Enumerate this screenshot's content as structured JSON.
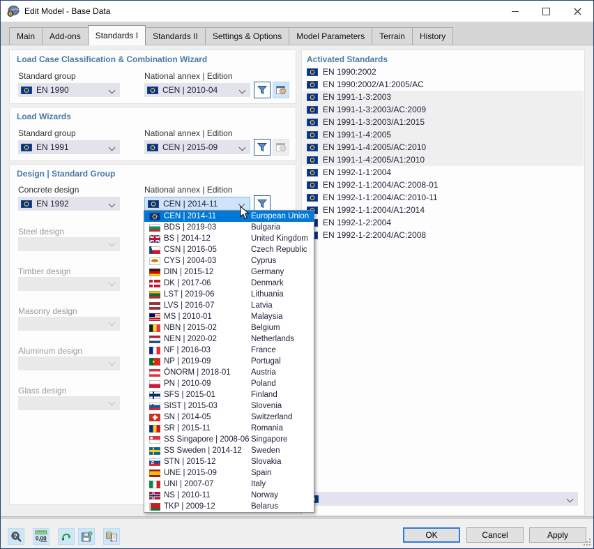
{
  "colors": {
    "accent": "#0078d7",
    "header_blue": "#4a7aa8",
    "selection": "#0078d7"
  },
  "window": {
    "title": "Edit Model - Base Data"
  },
  "tabs": [
    {
      "label": "Main"
    },
    {
      "label": "Add-ons"
    },
    {
      "label": "Standards I",
      "active": true
    },
    {
      "label": "Standards II"
    },
    {
      "label": "Settings & Options"
    },
    {
      "label": "Model Parameters"
    },
    {
      "label": "Terrain"
    },
    {
      "label": "History"
    }
  ],
  "panels": {
    "lcc": {
      "title": "Load Case Classification & Combination Wizard",
      "group_label": "Standard group",
      "group_value": "EN 1990",
      "annex_label": "National annex | Edition",
      "annex_value": "CEN | 2010-04"
    },
    "wizards": {
      "title": "Load Wizards",
      "group_label": "Standard group",
      "group_value": "EN 1991",
      "annex_label": "National annex | Edition",
      "annex_value": "CEN | 2015-09"
    },
    "design": {
      "title": "Design | Standard Group",
      "concrete_label": "Concrete design",
      "concrete_value": "EN 1992",
      "annex_label": "National annex | Edition",
      "annex_value": "CEN | 2014-11",
      "disabled": [
        {
          "label": "Steel design"
        },
        {
          "label": "Timber design"
        },
        {
          "label": "Masonry design"
        },
        {
          "label": "Aluminum design"
        },
        {
          "label": "Glass design"
        }
      ]
    }
  },
  "annex_dropdown": {
    "items": [
      {
        "flag": "eu",
        "code": "CEN | 2014-11",
        "country": "European Union",
        "selected": true
      },
      {
        "flag": "bg",
        "code": "BDS | 2019-03",
        "country": "Bulgaria"
      },
      {
        "flag": "gb",
        "code": "BS | 2014-12",
        "country": "United Kingdom"
      },
      {
        "flag": "cz",
        "code": "CSN | 2016-05",
        "country": "Czech Republic"
      },
      {
        "flag": "cy",
        "code": "CYS | 2004-03",
        "country": "Cyprus"
      },
      {
        "flag": "de",
        "code": "DIN | 2015-12",
        "country": "Germany"
      },
      {
        "flag": "dk",
        "code": "DK | 2017-06",
        "country": "Denmark"
      },
      {
        "flag": "lt",
        "code": "LST | 2019-06",
        "country": "Lithuania"
      },
      {
        "flag": "lv",
        "code": "LVS | 2016-07",
        "country": "Latvia"
      },
      {
        "flag": "my",
        "code": "MS | 2010-01",
        "country": "Malaysia"
      },
      {
        "flag": "be",
        "code": "NBN | 2015-02",
        "country": "Belgium"
      },
      {
        "flag": "nl",
        "code": "NEN | 2020-02",
        "country": "Netherlands"
      },
      {
        "flag": "fr",
        "code": "NF | 2016-03",
        "country": "France"
      },
      {
        "flag": "pt",
        "code": "NP | 2019-09",
        "country": "Portugal"
      },
      {
        "flag": "at",
        "code": "ÖNORM | 2018-01",
        "country": "Austria"
      },
      {
        "flag": "pl",
        "code": "PN | 2010-09",
        "country": "Poland"
      },
      {
        "flag": "fi",
        "code": "SFS | 2015-01",
        "country": "Finland"
      },
      {
        "flag": "si",
        "code": "SIST | 2015-03",
        "country": "Slovenia"
      },
      {
        "flag": "ch",
        "code": "SN | 2014-05",
        "country": "Switzerland"
      },
      {
        "flag": "ro",
        "code": "SR | 2015-11",
        "country": "Romania"
      },
      {
        "flag": "sg",
        "code": "SS Singapore | 2008-06",
        "country": "Singapore"
      },
      {
        "flag": "se",
        "code": "SS Sweden | 2014-12",
        "country": "Sweden"
      },
      {
        "flag": "sk",
        "code": "STN | 2015-12",
        "country": "Slovakia"
      },
      {
        "flag": "es",
        "code": "UNE | 2015-09",
        "country": "Spain"
      },
      {
        "flag": "it",
        "code": "UNI | 2007-07",
        "country": "Italy"
      },
      {
        "flag": "no",
        "code": "NS | 2010-11",
        "country": "Norway"
      },
      {
        "flag": "by",
        "code": "TKP | 2009-12",
        "country": "Belarus"
      }
    ]
  },
  "activated": {
    "title": "Activated Standards",
    "items": [
      {
        "flag": "eu",
        "label": "EN 1990:2002"
      },
      {
        "flag": "eu",
        "label": "EN 1990:2002/A1:2005/AC"
      },
      {
        "flag": "eu",
        "label": "EN 1991-1-3:2003",
        "shaded": true
      },
      {
        "flag": "eu",
        "label": "EN 1991-1-3:2003/AC:2009",
        "shaded": true
      },
      {
        "flag": "eu",
        "label": "EN 1991-1-3:2003/A1:2015",
        "shaded": true
      },
      {
        "flag": "eu",
        "label": "EN 1991-1-4:2005",
        "shaded": true
      },
      {
        "flag": "eu",
        "label": "EN 1991-1-4:2005/AC:2010",
        "shaded": true
      },
      {
        "flag": "eu",
        "label": "EN 1991-1-4:2005/A1:2010",
        "shaded": true
      },
      {
        "flag": "eu",
        "label": "EN 1992-1-1:2004"
      },
      {
        "flag": "eu",
        "label": "EN 1992-1-1:2004/AC:2008-01"
      },
      {
        "flag": "eu",
        "label": "EN 1992-1-1:2004/AC:2010-11"
      },
      {
        "flag": "eu",
        "label": "EN 1992-1-1:2004/A1:2014"
      },
      {
        "flag": "eu",
        "label": "EN 1992-1-2:2004"
      },
      {
        "flag": "eu",
        "label": "EN 1992-1-2:2004/AC:2008"
      }
    ]
  },
  "footer": {
    "ok": "OK",
    "cancel": "Cancel",
    "apply": "Apply",
    "units_label": "0,00"
  }
}
